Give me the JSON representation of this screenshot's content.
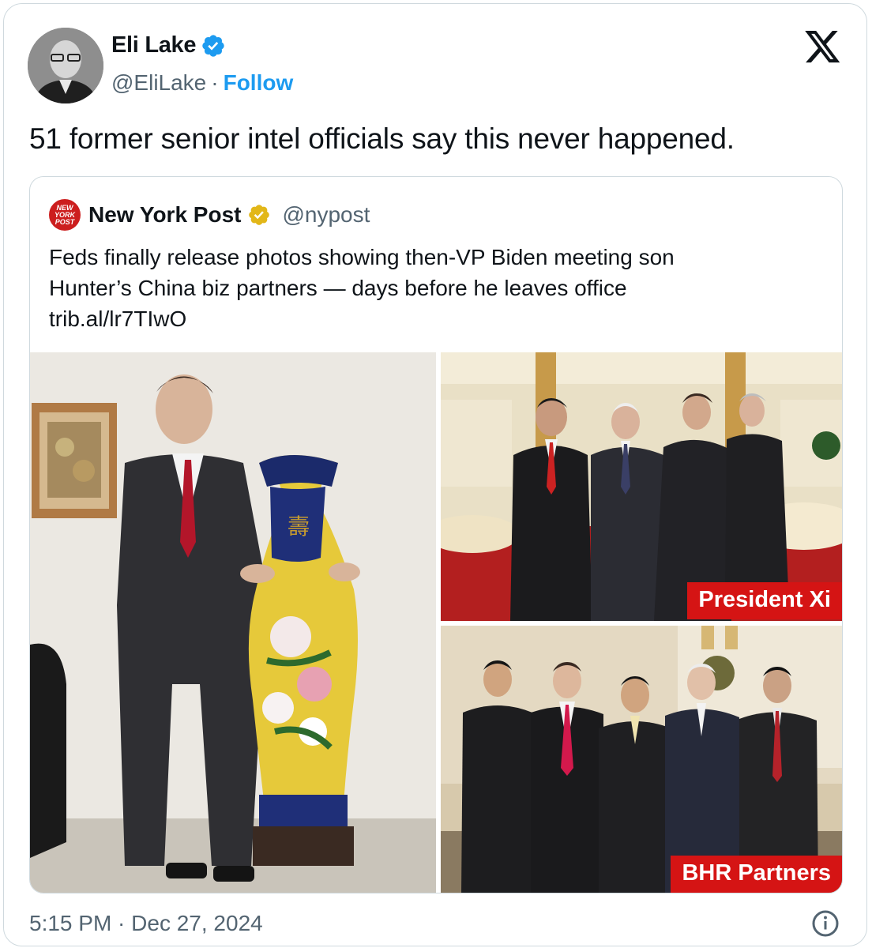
{
  "author": {
    "name": "Eli Lake",
    "handle": "@EliLake",
    "separator": "·",
    "follow_label": "Follow"
  },
  "tweet_text": "51 former senior intel officials say this never happened.",
  "quoted": {
    "logo_text": "NEW YORK POST",
    "name": "New York Post",
    "handle": "@nypost",
    "text_line1": "Feds finally release photos showing then-VP Biden meeting son",
    "text_line2": "Hunter’s China biz partners — days before he leaves office",
    "link": "trib.al/lr7TIwO",
    "photos": {
      "top_label": "President Xi",
      "bottom_label": "BHR Partners"
    }
  },
  "footer": {
    "timestamp": "5:15 PM · Dec 27, 2024"
  },
  "icons": {
    "verified": "verified-badge-icon",
    "gold_verified": "gold-verified-badge-icon",
    "x_logo": "x-logo-icon",
    "info": "info-icon"
  },
  "colors": {
    "accent": "#1d9bf0",
    "secondary_text": "#536471",
    "border": "#cfd9de",
    "label_red": "#d51414",
    "gold": "#e2b719"
  }
}
